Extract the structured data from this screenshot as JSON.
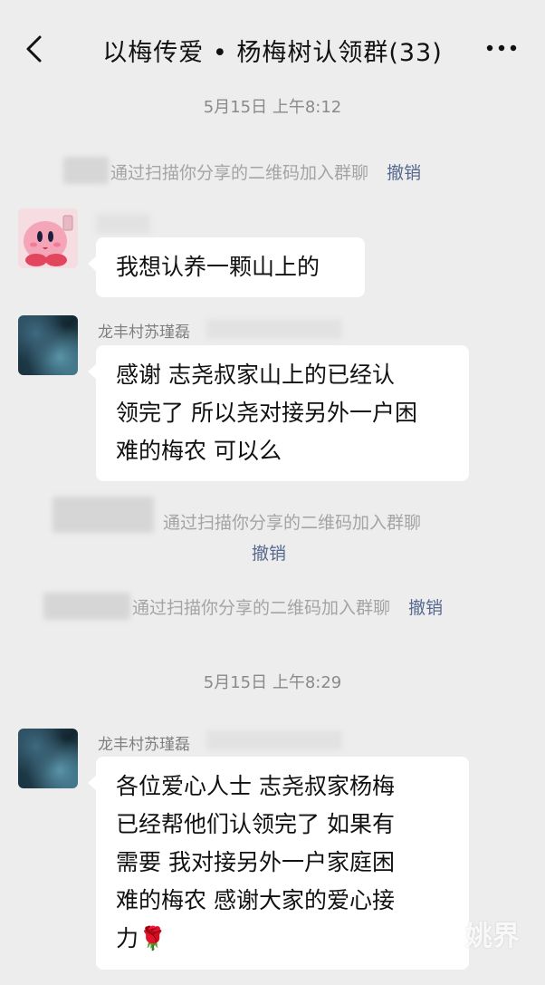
{
  "header": {
    "title": "以梅传爱 • 杨梅树认领群(33)",
    "back_icon": "chevron-left-icon",
    "more_icon": "more-dots-icon"
  },
  "timestamps": [
    "5月15日 上午8:12",
    "5月15日 上午8:29"
  ],
  "system_messages": [
    {
      "text": "通过扫描你分享的二维码加入群聊",
      "action": "撤销"
    },
    {
      "text": "通过扫描你分享的二维码加入群聊",
      "action": "撤销"
    },
    {
      "text": "通过扫描你分享的二维码加入群聊",
      "action": "撤销"
    }
  ],
  "messages": [
    {
      "avatar": "kirby-avatar",
      "sender": "",
      "lines": [
        "我想认养一颗山上的"
      ]
    },
    {
      "avatar": "rock-sea-avatar",
      "sender": "龙丰村苏瑾磊",
      "lines": [
        "感谢  志尧叔家山上的已经认",
        "领完了 所以尧对接另外一户困",
        "难的梅农  可以么"
      ]
    },
    {
      "avatar": "rock-sea-avatar",
      "sender": "龙丰村苏瑾磊",
      "lines": [
        "各位爱心人士  志尧叔家杨梅",
        "已经帮他们认领完了  如果有",
        "需要  我对接另外一户家庭困",
        "难的梅农  感谢大家的爱心接",
        "力🌹"
      ]
    }
  ],
  "watermark": "姚界",
  "colors": {
    "background": "#ededed",
    "bubble": "#ffffff",
    "revoke_link": "#57698f",
    "system_text": "#a4a4a4"
  }
}
